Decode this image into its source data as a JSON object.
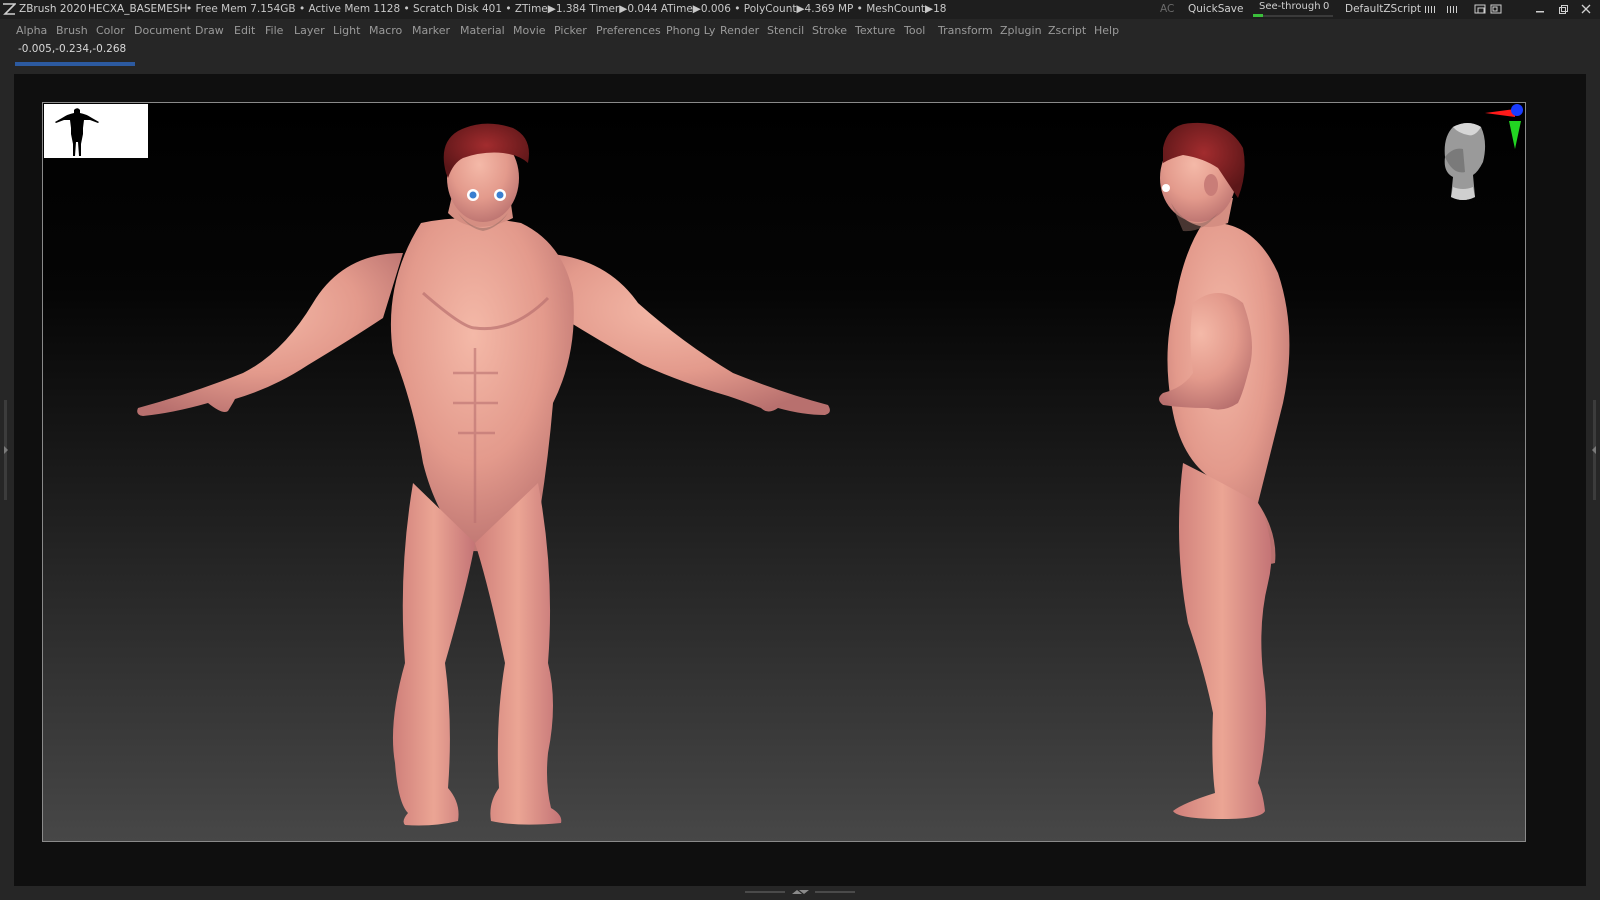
{
  "app": {
    "title": "ZBrush 2020",
    "document_name": "HECXA_BASEMESH",
    "stats": "• Free Mem 7.154GB • Active Mem 1128 • Scratch Disk 401 •  ZTime▶1.384 Timer▶0.044 ATime▶0.006 • PolyCount▶4.369 MP  • MeshCount▶18"
  },
  "titlebar_right": {
    "ac_label": "AC",
    "quicksave_label": "QuickSave",
    "see_through_label": "See-through",
    "see_through_value": "0",
    "see_through_fraction": 0.12,
    "zscript_label": "DefaultZScript"
  },
  "menu": {
    "items": [
      "Alpha",
      "Brush",
      "Color",
      "Document",
      "Draw",
      "Edit",
      "File",
      "Layer",
      "Light",
      "Macro",
      "Marker",
      "Material",
      "Movie",
      "Picker",
      "Preferences",
      "Phong Ly",
      "Render",
      "Stencil",
      "Stroke",
      "Texture",
      "Tool",
      "Transform",
      "Zplugin",
      "Zscript",
      "Help"
    ]
  },
  "readout": {
    "coordinates": "-0.005,-0.234,-0.268",
    "progress_fraction": 1.0
  },
  "colors": {
    "skin": "#e49a8a",
    "skin_shadow": "#b5686a",
    "skin_highlight": "#f3b8a6",
    "hair": "#7a1f22",
    "canvas_top": "#000000",
    "canvas_bottom": "#474747",
    "progress_accent": "#2c5aa0",
    "see_through_accent": "#3bbf3b"
  },
  "icons": {
    "logo": "zbrush-logo-icon",
    "thumbnail": "model-silhouette-icon",
    "navigator": "navigation-head-icon",
    "gizmo": "axis-gizmo-icon",
    "minimize": "minimize-icon",
    "restore": "restore-icon",
    "close": "close-icon"
  }
}
